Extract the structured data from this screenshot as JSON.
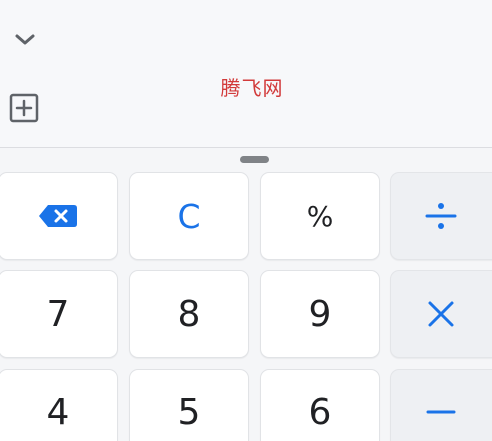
{
  "app": {
    "watermark": "腾飞网",
    "accent_color": "#1a73e8",
    "watermark_color": "#d23a3a"
  },
  "display": {
    "collapse_icon": "chevron-down-icon",
    "add_icon": "plus-square-icon"
  },
  "keypad": {
    "backspace_icon": "backspace-icon",
    "clear_label": "C",
    "percent_label": "%",
    "divide_icon": "divide-icon",
    "multiply_icon": "multiply-icon",
    "minus_icon": "minus-icon",
    "digits": {
      "seven": "7",
      "eight": "8",
      "nine": "9",
      "four": "4",
      "five": "5",
      "six": "6"
    }
  }
}
